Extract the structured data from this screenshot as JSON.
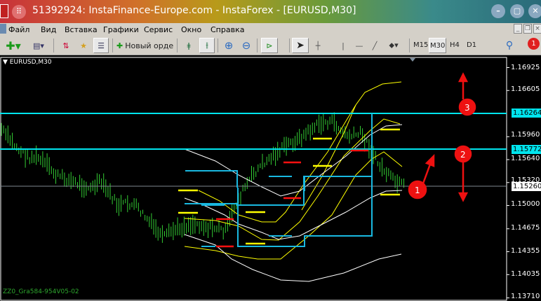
{
  "window": {
    "title": "51392924: InstaFinance-Europe.com - InstaForex - [EURUSD,M30]",
    "min": "–",
    "max": "▢",
    "close": "✕"
  },
  "menu": [
    "Файл",
    "Вид",
    "Вставка",
    "Графики",
    "Сервис",
    "Окно",
    "Справка"
  ],
  "toolbar": {
    "new_order": "Новый орде",
    "timeframes": [
      "M15",
      "M30",
      "H4",
      "D1"
    ],
    "active_timeframe": "M30",
    "notification_count": "1"
  },
  "chart": {
    "symbol_label": "EURUSD,M30",
    "indicator_label": "ZZ0_Gra584-954V05-02",
    "price_axis": [
      "1.16925",
      "1.16605",
      "1.15960",
      "1.15640",
      "1.15320",
      "1.15000",
      "1.14675",
      "1.14355",
      "1.14035",
      "1.13710"
    ],
    "levels": [
      {
        "price": "1.16264",
        "color": "#00e5ee"
      },
      {
        "price": "1.15772",
        "color": "#00e5ee"
      },
      {
        "price": "1.15260",
        "color": "#808890",
        "label": "bid"
      }
    ],
    "bar_color": "#33cc33",
    "price_path": [
      1.1606,
      1.1591,
      1.1577,
      1.1567,
      1.1567,
      1.1557,
      1.1543,
      1.1538,
      1.1533,
      1.1528,
      1.1523,
      1.1533,
      1.1518,
      1.1499,
      1.1503,
      1.1499,
      1.1484,
      1.1469,
      1.1455,
      1.1464,
      1.1469,
      1.1474,
      1.1474,
      1.1469,
      1.1469,
      1.1464,
      1.1499,
      1.1523,
      1.1543,
      1.1557,
      1.1567,
      1.1577,
      1.1586,
      1.1591,
      1.1601,
      1.1611,
      1.1616,
      1.1616,
      1.1601,
      1.1596,
      1.1601,
      1.1581,
      1.1557,
      1.1543,
      1.1531,
      1.1527
    ],
    "annotations": [
      "1",
      "2",
      "3"
    ]
  },
  "colors": {
    "cyan": "#00e5ee",
    "box": "#19b8e0",
    "yellow": "#ffff00",
    "red": "#ff1010",
    "marker": "#ee1111"
  }
}
